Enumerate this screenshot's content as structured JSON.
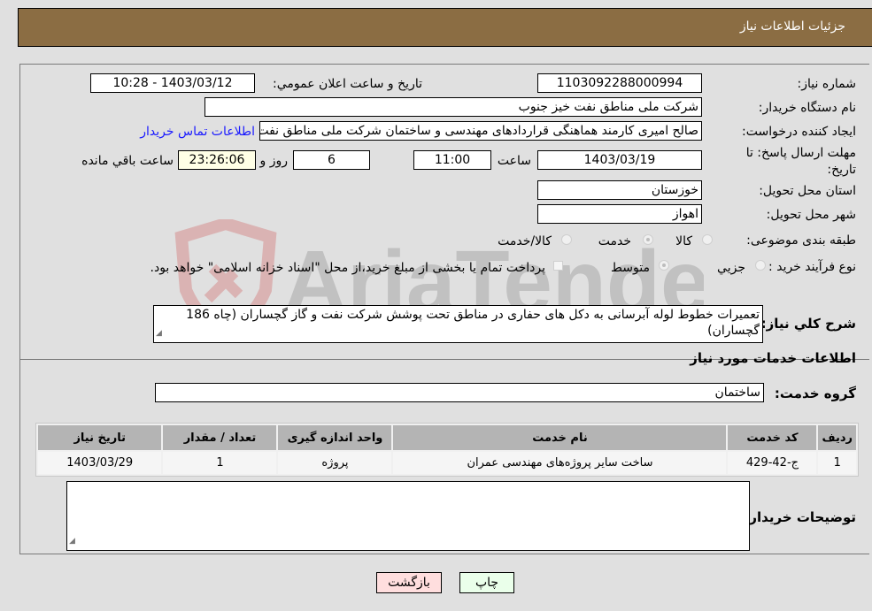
{
  "header": {
    "title": "جزئیات اطلاعات نیاز"
  },
  "form": {
    "need_number": {
      "label": "شماره نیاز:",
      "value": "1103092288000994"
    },
    "announce_datetime": {
      "label": "تاریخ و ساعت اعلان عمومي:",
      "value": "1403/03/12 - 10:28"
    },
    "buyer_org": {
      "label": "نام دستگاه خریدار:",
      "value": "شرکت ملی مناطق نفت خیز جنوب"
    },
    "requester": {
      "label": "ایجاد کننده درخواست:",
      "value": "صالح امیری کارمند هماهنگی قراردادهای مهندسی و ساختمان شرکت ملی مناطق نفت خیز جنوب",
      "contact_link": "اطلاعات تماس خریدار"
    },
    "deadline": {
      "label": "مهلت ارسال پاسخ: تا تاریخ:",
      "date": "1403/03/19",
      "time_label": "ساعت",
      "time": "11:00",
      "days": "6",
      "days_label": "روز و",
      "remaining": "23:26:06",
      "remaining_label": "ساعت باقي مانده"
    },
    "province": {
      "label": "استان محل تحویل:",
      "value": "خوزستان"
    },
    "city": {
      "label": "شهر محل تحویل:",
      "value": "اهواز"
    },
    "category": {
      "label": "طبقه بندی موضوعی:",
      "options": [
        "کالا",
        "خدمت",
        "کالا/خدمت"
      ],
      "selected": "خدمت"
    },
    "purchase_type": {
      "label": "نوع فرآیند خرید :",
      "options": [
        "جزيي",
        "متوسط"
      ],
      "selected": "متوسط",
      "treasury_note": "پرداخت تمام یا بخشی از مبلغ خرید،از محل \"اسناد خزانه اسلامی\" خواهد بود.",
      "treasury_checked": false
    },
    "description": {
      "label": "شرح کلي نیاز:",
      "value": "تعمیرات خطوط لوله آبرسانی به دکل های حفاری در مناطق تحت پوشش شرکت نفت و گاز گچساران (چاه 186 گچساران)"
    }
  },
  "services": {
    "section_title": "اطلاعات خدمات مورد نیاز",
    "group_label": "گروه خدمت:",
    "group_value": "ساختمان",
    "table": {
      "headers": [
        "ردیف",
        "کد خدمت",
        "نام خدمت",
        "واحد اندازه گیری",
        "تعداد / مقدار",
        "تاریخ نیاز"
      ],
      "rows": [
        [
          "1",
          "ج-42-429",
          "ساخت سایر پروژه‌های مهندسی عمران",
          "پروژه",
          "1",
          "1403/03/29"
        ]
      ]
    },
    "buyer_notes_label": "توضیحات خریدار:",
    "buyer_notes_value": ""
  },
  "buttons": {
    "print": "چاپ",
    "back": "بازگشت"
  },
  "watermark": {
    "text": "AriaTender.neT"
  },
  "colors": {
    "header_bg": "#8b6d43",
    "print_bg": "#eaffea",
    "back_bg": "#ffdede",
    "link": "#1a1aff"
  }
}
